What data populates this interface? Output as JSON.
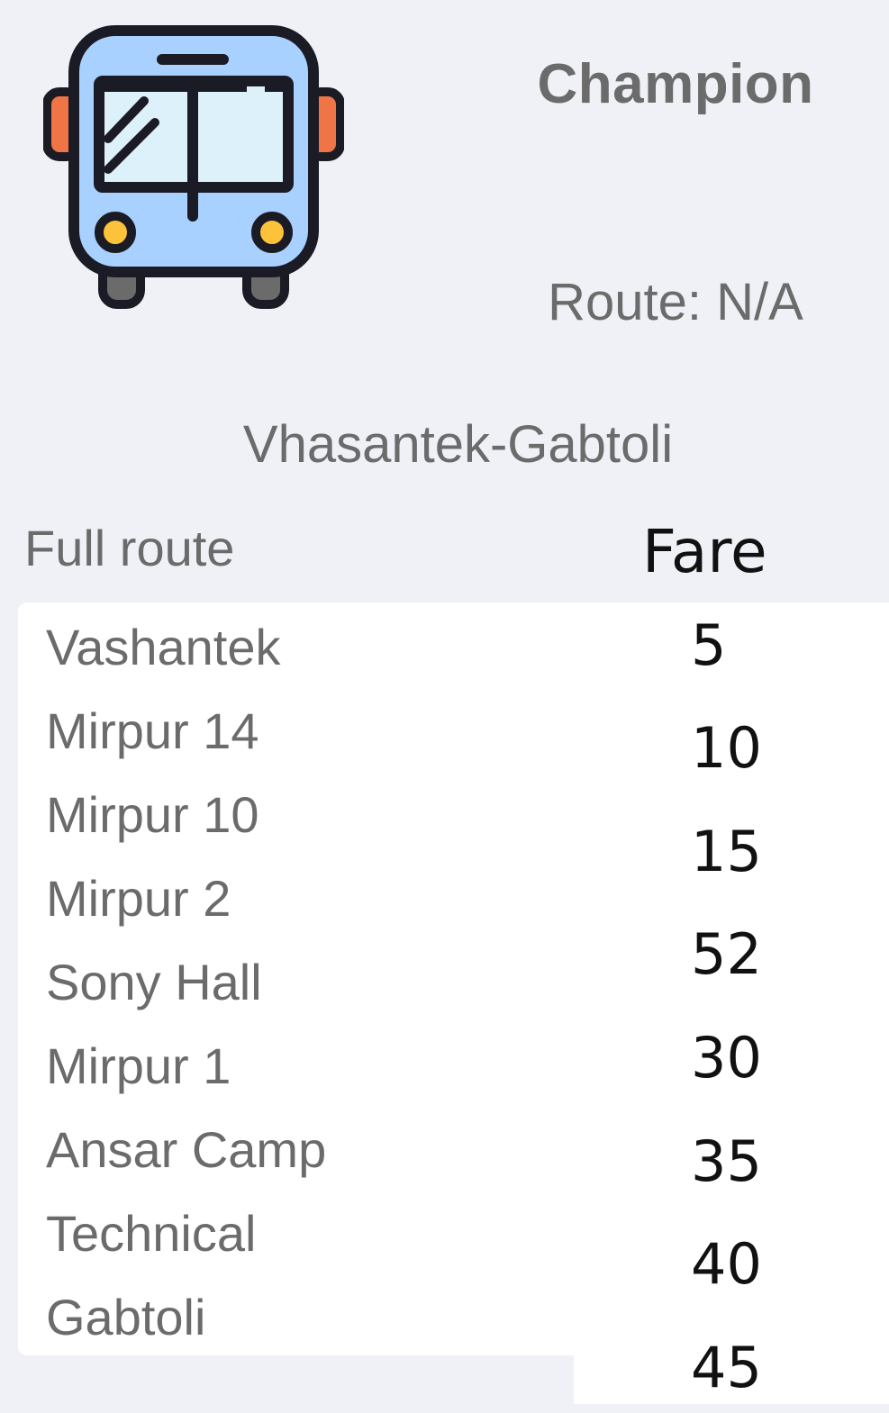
{
  "header": {
    "bus_name": "Champion",
    "route_code": "Route: N/A",
    "icon": "bus-front-icon",
    "colors": {
      "bus_body": "#a8d1ff",
      "bus_window": "#ddf1fb",
      "bus_outline": "#1b1b26",
      "mirror": "#ef7446",
      "headlight": "#fcc23a",
      "tyre": "#6b6b6b"
    }
  },
  "route_title": "Vhasantek-Gabtoli",
  "table": {
    "stops_header": "Full route",
    "fare_header": "Fare",
    "stops": [
      "Vashantek",
      "Mirpur 14",
      "Mirpur 10",
      "Mirpur 2",
      "Sony Hall",
      "Mirpur 1",
      "Ansar Camp",
      "Technical",
      "Gabtoli"
    ],
    "fares": [
      "5",
      "10",
      "15",
      "52",
      "30",
      "35",
      "40",
      "45"
    ]
  }
}
